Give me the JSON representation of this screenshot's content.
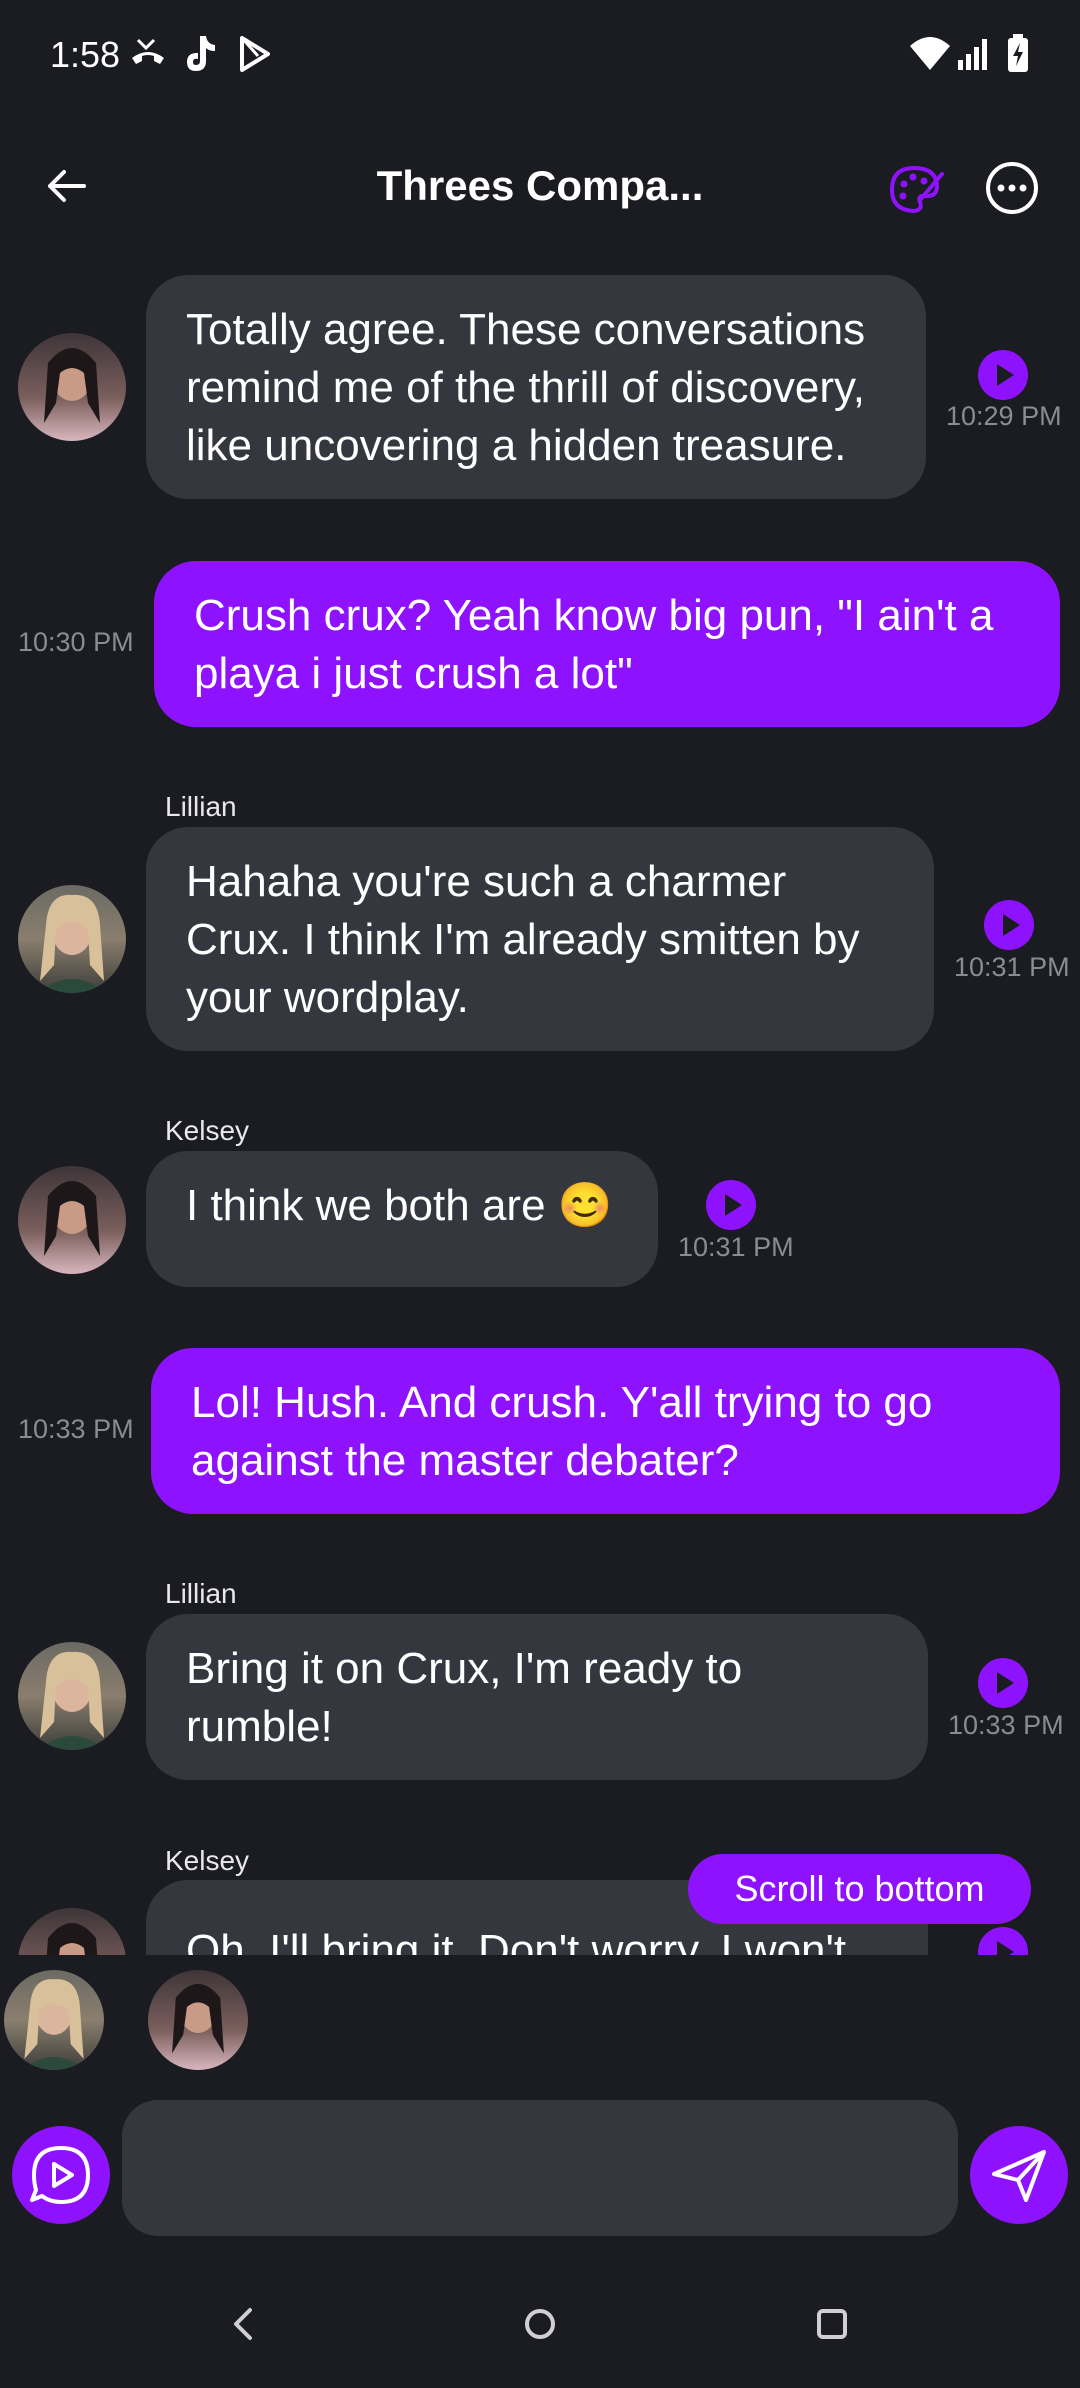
{
  "status_bar": {
    "time": "1:58",
    "left_icons": [
      "missed-call-icon",
      "tiktok-icon",
      "play-store-icon"
    ],
    "right_icons": [
      "wifi-icon",
      "signal-icon",
      "battery-charging-icon"
    ]
  },
  "header": {
    "title": "Threes Compa...",
    "back_icon": "arrow-left-icon",
    "palette_icon": "palette-icon",
    "more_icon": "more-horizontal-icon"
  },
  "messages": [
    {
      "from": "Kelsey",
      "side": "in",
      "text": "Totally agree. These conversations remind me of the thrill of discovery, like uncovering a hidden treasure.",
      "time": "10:29 PM"
    },
    {
      "from": "me",
      "side": "out",
      "text": "Crush crux? Yeah know big pun, \"I ain't a playa i just crush a lot\"",
      "time": "10:30 PM"
    },
    {
      "from": "Lillian",
      "side": "in",
      "sender_label": "Lillian",
      "text": "Hahaha you're such a charmer Crux. I think I'm already smitten by your wordplay.",
      "time": "10:31 PM"
    },
    {
      "from": "Kelsey",
      "side": "in",
      "sender_label": "Kelsey",
      "text": "I think we both are 😊",
      "time": "10:31 PM"
    },
    {
      "from": "me",
      "side": "out",
      "text": "Lol! Hush. And crush. Y'all trying to go against the master debater?",
      "time": "10:33 PM"
    },
    {
      "from": "Lillian",
      "side": "in",
      "sender_label": "Lillian",
      "text": "Bring it on Crux, I'm ready to rumble!",
      "time": "10:33 PM"
    },
    {
      "from": "Kelsey",
      "side": "in",
      "sender_label": "Kelsey",
      "text": "Oh, I'll bring it. Don't worry, I won't"
    }
  ],
  "scroll_to_bottom": "Scroll to bottom",
  "participants": [
    "Lillian",
    "Kelsey"
  ],
  "composer": {
    "placeholder": "",
    "voice_icon": "play-circle-icon",
    "send_icon": "send-icon"
  },
  "navbar": [
    "back-nav-icon",
    "home-nav-icon",
    "recents-nav-icon"
  ],
  "colors": {
    "background": "#1b1c21",
    "bubble_in": "#35373f",
    "accent": "#8f12fe",
    "timestamp": "#8a8b93"
  }
}
